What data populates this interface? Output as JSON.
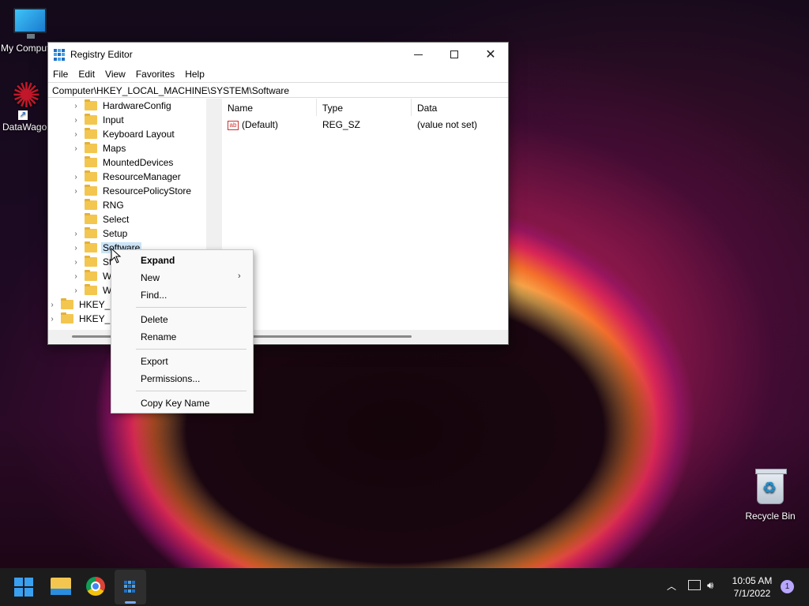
{
  "desktop": {
    "icons": [
      {
        "label": "My Computer",
        "icon": "monitor-icon"
      },
      {
        "label": "DataWagon",
        "icon": "datawagon-icon"
      },
      {
        "label": "Recycle Bin",
        "icon": "recycle-bin-icon"
      }
    ]
  },
  "window": {
    "title": "Registry Editor",
    "menu": [
      "File",
      "Edit",
      "View",
      "Favorites",
      "Help"
    ],
    "address": "Computer\\HKEY_LOCAL_MACHINE\\SYSTEM\\Software",
    "tree": [
      {
        "label": "HardwareConfig",
        "expandable": true
      },
      {
        "label": "Input",
        "expandable": true
      },
      {
        "label": "Keyboard Layout",
        "expandable": true
      },
      {
        "label": "Maps",
        "expandable": true
      },
      {
        "label": "MountedDevices",
        "expandable": false
      },
      {
        "label": "ResourceManager",
        "expandable": true
      },
      {
        "label": "ResourcePolicyStore",
        "expandable": true
      },
      {
        "label": "RNG",
        "expandable": false
      },
      {
        "label": "Select",
        "expandable": false
      },
      {
        "label": "Setup",
        "expandable": true
      },
      {
        "label": "Software",
        "expandable": true,
        "selected": true
      },
      {
        "label": "Sta",
        "expandable": true
      },
      {
        "label": "Wa",
        "expandable": true
      },
      {
        "label": "WP",
        "expandable": true
      },
      {
        "label": "HKEY_US",
        "expandable": true,
        "root": true
      },
      {
        "label": "HKEY_CU",
        "expandable": true,
        "root": true
      }
    ],
    "columns": [
      "Name",
      "Type",
      "Data"
    ],
    "values": [
      {
        "name": "(Default)",
        "type": "REG_SZ",
        "data": "(value not set)",
        "icon": "ab"
      }
    ]
  },
  "context_menu": {
    "items": [
      "Expand",
      "New",
      "Find...",
      "Delete",
      "Rename",
      "Export",
      "Permissions...",
      "Copy Key Name"
    ]
  },
  "taskbar": {
    "time": "10:05 AM",
    "date": "7/1/2022",
    "notification_count": "1"
  },
  "colors": {
    "accent": "#3aa0f0",
    "selection": "#cce4f7",
    "folder": "#f3c64f"
  }
}
